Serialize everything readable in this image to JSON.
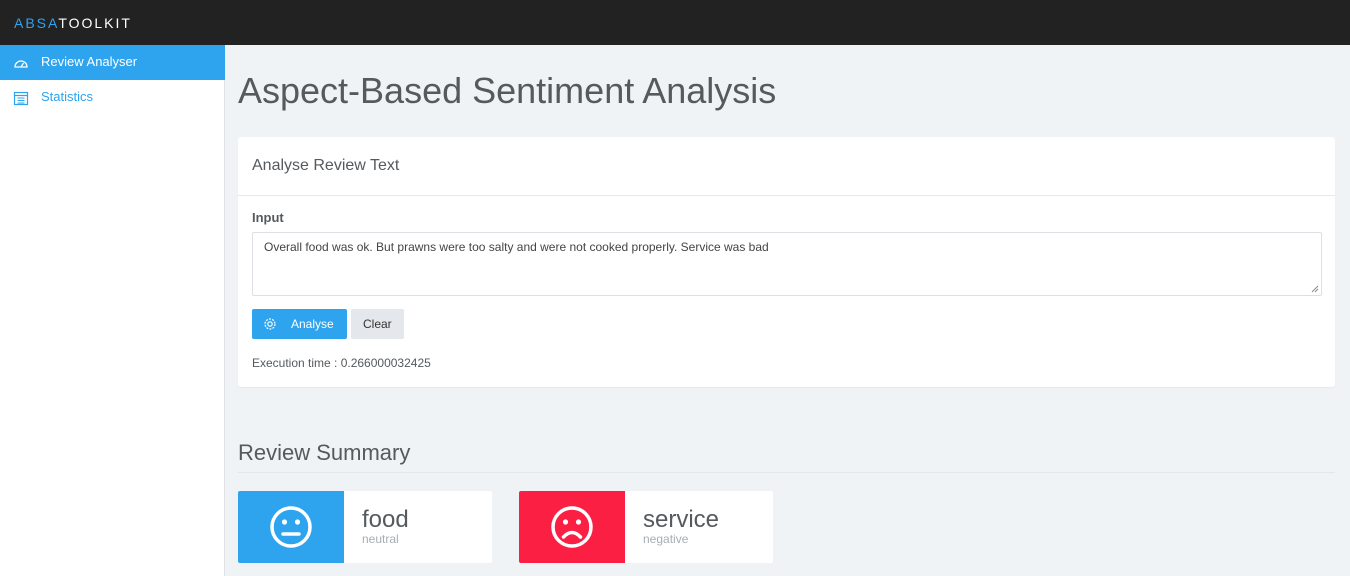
{
  "brand": {
    "part1": "ABSA",
    "part2": "TOOLKIT"
  },
  "sidebar": {
    "items": [
      {
        "label": "Review Analyser",
        "icon": "dashboard-gauge-icon",
        "active": true
      },
      {
        "label": "Statistics",
        "icon": "calendar-icon",
        "active": false
      }
    ]
  },
  "main": {
    "title": "Aspect-Based Sentiment Analysis",
    "panel": {
      "heading": "Analyse Review Text",
      "input_label": "Input",
      "input_value": "Overall food was ok. But prawns were too salty and were not cooked properly. Service was bad",
      "analyse_label": "Analyse",
      "clear_label": "Clear",
      "execution_time": "Execution time : 0.266000032425"
    },
    "summary": {
      "title": "Review Summary",
      "cards": [
        {
          "aspect": "food",
          "sentiment": "neutral",
          "icon": "neutral-face-icon",
          "color": "#2ea3ee"
        },
        {
          "aspect": "service",
          "sentiment": "negative",
          "icon": "sad-face-icon",
          "color": "#fc1f44"
        }
      ]
    }
  },
  "colors": {
    "accent": "#2ea3ee",
    "negative": "#fc1f44",
    "topbar": "#222222",
    "background": "#eff3f6"
  }
}
